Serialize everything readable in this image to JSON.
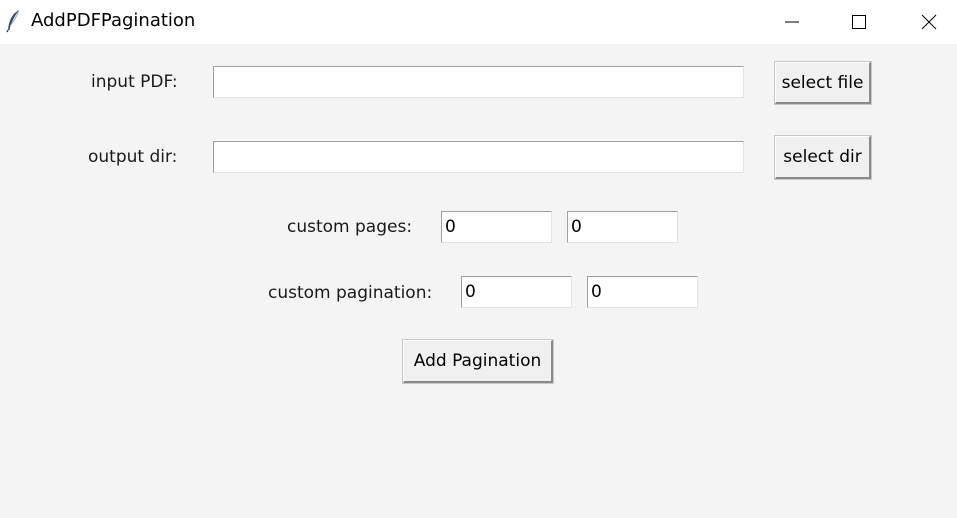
{
  "window": {
    "title": "AddPDFPagination",
    "icon": "feather-icon",
    "controls": [
      "minimize-icon",
      "maximize-icon",
      "close-icon"
    ]
  },
  "form": {
    "input_pdf": {
      "label": "input PDF:",
      "value": "",
      "button": "select file"
    },
    "output_dir": {
      "label": "output dir:",
      "value": "",
      "button": "select dir"
    },
    "custom_pages": {
      "label": "custom pages:",
      "value_1": "0",
      "value_2": "0"
    },
    "custom_pagination": {
      "label": "custom pagination:",
      "value_1": "0",
      "value_2": "0"
    },
    "submit_label": "Add Pagination"
  }
}
